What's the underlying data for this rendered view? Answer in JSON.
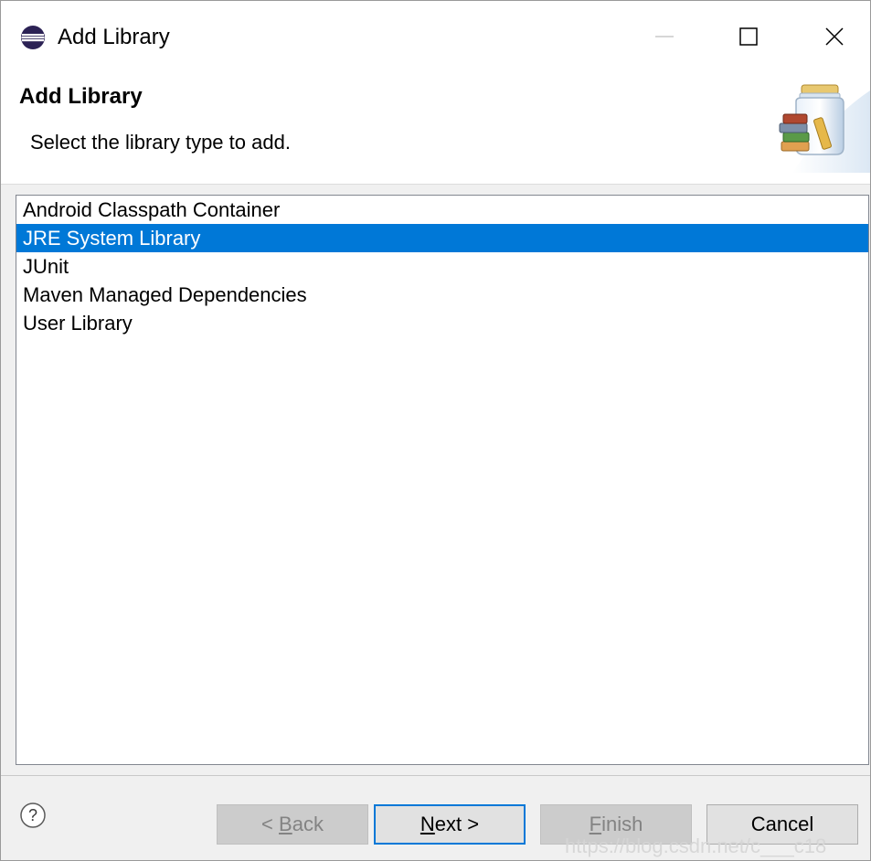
{
  "window": {
    "title": "Add Library",
    "icon": "eclipse-icon"
  },
  "banner": {
    "title": "Add Library",
    "description": "Select the library type to add.",
    "icon": "library-jar-icon"
  },
  "library_types": [
    {
      "label": "Android Classpath Container",
      "selected": false
    },
    {
      "label": "JRE System Library",
      "selected": true
    },
    {
      "label": "JUnit",
      "selected": false
    },
    {
      "label": "Maven Managed Dependencies",
      "selected": false
    },
    {
      "label": "User Library",
      "selected": false
    }
  ],
  "footer": {
    "help_icon": "help-icon",
    "back": {
      "prefix": "< ",
      "mnemonic": "B",
      "rest": "ack"
    },
    "next": {
      "mnemonic": "N",
      "rest": "ext >"
    },
    "finish": {
      "mnemonic": "F",
      "rest": "inish"
    },
    "cancel": "Cancel"
  },
  "watermark": "https://blog.csdn.net/c___c18",
  "colors": {
    "selection": "#0078d7",
    "default_button_border": "#0078d7",
    "disabled_text": "#838383"
  }
}
